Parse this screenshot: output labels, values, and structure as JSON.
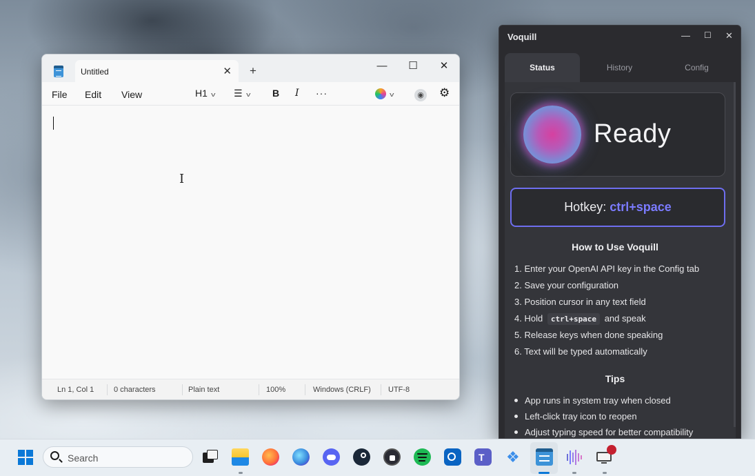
{
  "notepad": {
    "tab_title": "Untitled",
    "menus": [
      "File",
      "Edit",
      "View"
    ],
    "heading_select": "H1",
    "status": {
      "position": "Ln 1, Col 1",
      "characters": "0 characters",
      "format": "Plain text",
      "zoom": "100%",
      "line_ending": "Windows (CRLF)",
      "encoding": "UTF-8"
    }
  },
  "voquill": {
    "title": "Voquill",
    "tabs": [
      "Status",
      "History",
      "Config"
    ],
    "active_tab": "Status",
    "status_text": "Ready",
    "hotkey_label": "Hotkey:",
    "hotkey_value": "ctrl+space",
    "how_to_heading": "How to Use Voquill",
    "steps": [
      "1. Enter your OpenAI API key in the Config tab",
      "2. Save your configuration",
      "3. Position cursor in any text field",
      "4. Hold",
      "and speak",
      "5. Release keys when done speaking",
      "6. Text will be typed automatically"
    ],
    "step4_key": "ctrl+space",
    "tips_heading": "Tips",
    "tips": [
      "App runs in system tray when closed",
      "Left-click tray icon to reopen",
      "Adjust typing speed for better compatibility"
    ]
  },
  "taskbar": {
    "search_placeholder": "Search",
    "apps": [
      "task-view",
      "file-explorer",
      "firefox",
      "firefox-developer",
      "discord",
      "steam",
      "proton-pass",
      "spotify",
      "outlook",
      "teams",
      "vscode",
      "notepad",
      "voquill",
      "remote-desktop"
    ],
    "active_app": "notepad"
  },
  "colors": {
    "accent": "#0a78d7",
    "hotkey_accent": "#7b7bff",
    "voquill_bg": "#2b2b2f"
  }
}
